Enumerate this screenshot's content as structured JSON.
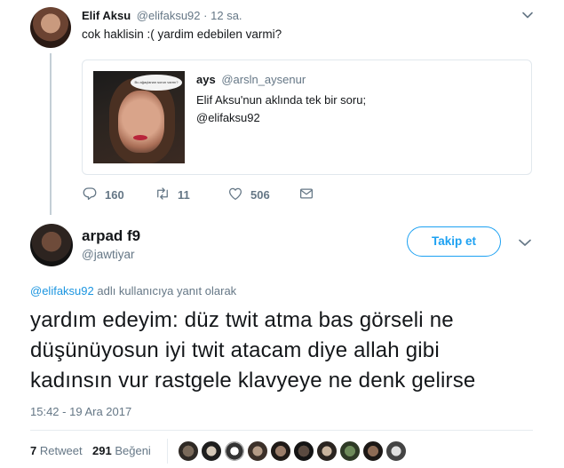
{
  "parent": {
    "name": "Elif Aksu",
    "handle": "@elifaksu92",
    "separator": "·",
    "time": "12 sa.",
    "text": "cok haklisin :( yardim edebilen varmi?",
    "quote": {
      "name": "ays",
      "handle": "@arsln_aysenur",
      "line1": "Elif Aksu'nun aklında tek bir soru;",
      "line2": "@elifaksu92",
      "bubble_text": "Bu ağaçlanan sorun varmı?"
    },
    "actions": {
      "replies": "160",
      "retweets": "11",
      "likes": "506"
    }
  },
  "reply": {
    "name": "arpad f9",
    "handle": "@jawtiyar",
    "follow_label": "Takip et",
    "reply_mention": "@elifaksu92",
    "reply_suffix": " adlı kullanıcıya yanıt olarak",
    "text_lines": [
      "yardım edeyim: düz twit atma bas görseli ne",
      "düşünüyosun iyi twit atacam diye allah gibi",
      "kadınsın vur rastgele klavyeye ne denk gelirse"
    ],
    "timestamp": "15:42 - 19 Ara 2017",
    "retweet_count": "7",
    "retweet_label": "Retweet",
    "like_count": "291",
    "like_label": "Beğeni"
  },
  "icons": {
    "reply": "reply-icon",
    "retweet": "retweet-icon",
    "like": "heart-icon",
    "message": "envelope-icon",
    "caret": "chevron-down-icon"
  },
  "colors": {
    "accent": "#1da1f2",
    "mention": "#1b95e0",
    "muted": "#657786",
    "text": "#14171a"
  }
}
